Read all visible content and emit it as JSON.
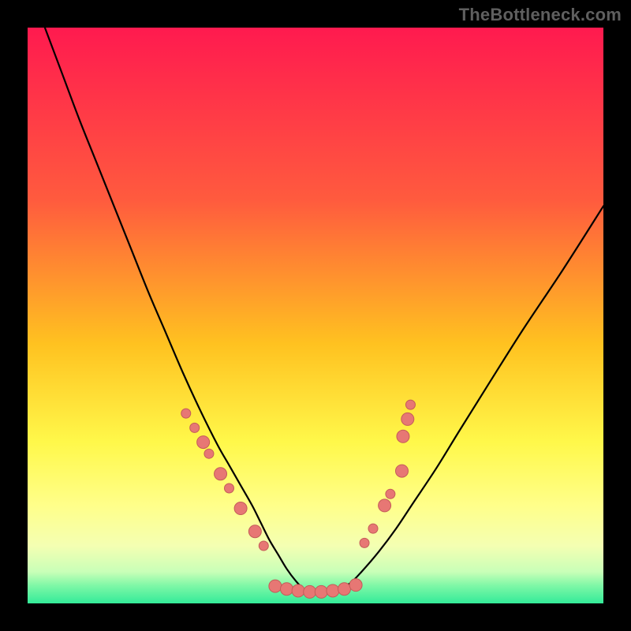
{
  "watermark": "TheBottleneck.com",
  "chart_data": {
    "type": "line",
    "title": "",
    "xlabel": "",
    "ylabel": "",
    "xlim": [
      0,
      100
    ],
    "ylim": [
      0,
      100
    ],
    "grid": false,
    "legend": false,
    "gradient_stops": [
      {
        "offset": 0,
        "color": "#ff1a4f"
      },
      {
        "offset": 0.3,
        "color": "#ff5b3e"
      },
      {
        "offset": 0.55,
        "color": "#ffc220"
      },
      {
        "offset": 0.72,
        "color": "#fff84a"
      },
      {
        "offset": 0.83,
        "color": "#ffff8a"
      },
      {
        "offset": 0.9,
        "color": "#f4ffb2"
      },
      {
        "offset": 0.945,
        "color": "#c9ffb8"
      },
      {
        "offset": 0.97,
        "color": "#7cf7a6"
      },
      {
        "offset": 1.0,
        "color": "#33eb99"
      }
    ],
    "curve": {
      "note": "Asymmetric V-shaped bottleneck curve; x in [0,100], y in [0,100] (0=bottom)",
      "x": [
        3,
        6,
        9,
        12,
        15,
        18,
        21,
        24,
        27,
        30,
        33,
        35,
        37,
        39,
        40.5,
        42,
        43.5,
        45,
        46.5,
        48,
        50,
        52,
        54,
        56,
        58,
        61,
        64,
        67,
        71,
        75,
        80,
        86,
        93,
        100
      ],
      "y": [
        100,
        92,
        84,
        76.5,
        69,
        61.5,
        54,
        47,
        40,
        33.5,
        27.5,
        24,
        20.5,
        17,
        14,
        11,
        8.5,
        6,
        4,
        2.5,
        2,
        2,
        2.5,
        3.5,
        5.5,
        9,
        13,
        17.5,
        23.5,
        30,
        38,
        47.5,
        58,
        69
      ]
    },
    "markers": {
      "color": "#e77774",
      "stroke": "#c45c59",
      "radius_small": 6,
      "radius_large": 8,
      "points": [
        {
          "x": 27.5,
          "y": 33.0,
          "r": "small"
        },
        {
          "x": 29.0,
          "y": 30.5,
          "r": "small"
        },
        {
          "x": 30.5,
          "y": 28.0,
          "r": "large"
        },
        {
          "x": 31.5,
          "y": 26.0,
          "r": "small"
        },
        {
          "x": 33.5,
          "y": 22.5,
          "r": "large"
        },
        {
          "x": 35.0,
          "y": 20.0,
          "r": "small"
        },
        {
          "x": 37.0,
          "y": 16.5,
          "r": "large"
        },
        {
          "x": 39.5,
          "y": 12.5,
          "r": "large"
        },
        {
          "x": 41.0,
          "y": 10.0,
          "r": "small"
        },
        {
          "x": 43.0,
          "y": 3.0,
          "r": "large"
        },
        {
          "x": 45.0,
          "y": 2.5,
          "r": "large"
        },
        {
          "x": 47.0,
          "y": 2.2,
          "r": "large"
        },
        {
          "x": 49.0,
          "y": 2.0,
          "r": "large"
        },
        {
          "x": 51.0,
          "y": 2.0,
          "r": "large"
        },
        {
          "x": 53.0,
          "y": 2.2,
          "r": "large"
        },
        {
          "x": 55.0,
          "y": 2.5,
          "r": "large"
        },
        {
          "x": 57.0,
          "y": 3.2,
          "r": "large"
        },
        {
          "x": 58.5,
          "y": 10.5,
          "r": "small"
        },
        {
          "x": 60.0,
          "y": 13.0,
          "r": "small"
        },
        {
          "x": 62.0,
          "y": 17.0,
          "r": "large"
        },
        {
          "x": 63.0,
          "y": 19.0,
          "r": "small"
        },
        {
          "x": 65.0,
          "y": 23.0,
          "r": "large"
        },
        {
          "x": 65.2,
          "y": 29.0,
          "r": "large"
        },
        {
          "x": 66.0,
          "y": 32.0,
          "r": "large"
        },
        {
          "x": 66.5,
          "y": 34.5,
          "r": "small"
        }
      ]
    }
  }
}
